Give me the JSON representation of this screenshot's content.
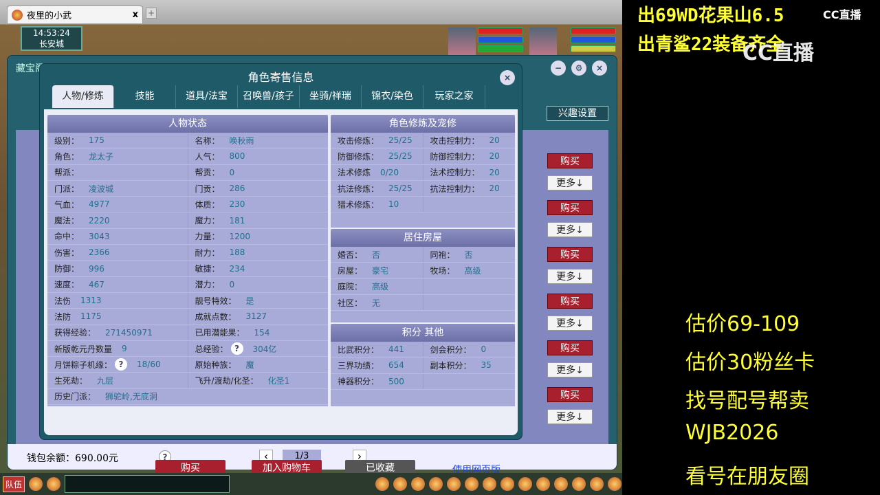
{
  "browser": {
    "tab_title": "夜里的小武",
    "close": "x",
    "new_tab": "+"
  },
  "hud": {
    "time": "14:53:24",
    "location": "长安城"
  },
  "outer": {
    "title": "藏宝阁",
    "interest_btn": "兴趣设置",
    "buy": "购买",
    "more": "更多↓",
    "wallet": "钱包余额：690.00元",
    "help": "?",
    "page": "1/3",
    "prev": "‹",
    "next": "›"
  },
  "dialog": {
    "title": "角色寄售信息",
    "close": "×",
    "tabs": [
      "人物/修炼",
      "技能",
      "道具/法宝",
      "召唤兽/孩子",
      "坐骑/祥瑞",
      "锦衣/染色",
      "玩家之家"
    ],
    "status": {
      "title": "人物状态",
      "rows": [
        [
          [
            "级别：",
            "175"
          ],
          [
            "名称：",
            "唤秋雨"
          ]
        ],
        [
          [
            "角色：",
            "龙太子"
          ],
          [
            "人气：",
            "800"
          ]
        ],
        [
          [
            "帮派：",
            ""
          ],
          [
            "帮贡：",
            "0"
          ]
        ],
        [
          [
            "门派：",
            "凌波城"
          ],
          [
            "门贡：",
            "286"
          ]
        ],
        [
          [
            "气血：",
            "4977"
          ],
          [
            "体质：",
            "230"
          ]
        ],
        [
          [
            "魔法：",
            "2220"
          ],
          [
            "魔力：",
            "181"
          ]
        ],
        [
          [
            "命中：",
            "3043"
          ],
          [
            "力量：",
            "1200"
          ]
        ],
        [
          [
            "伤害：",
            "2366"
          ],
          [
            "耐力：",
            "188"
          ]
        ],
        [
          [
            "防御：",
            "996"
          ],
          [
            "敏捷：",
            "234"
          ]
        ],
        [
          [
            "速度：",
            "467"
          ],
          [
            "潜力：",
            "0"
          ]
        ],
        [
          [
            "法伤",
            "1313"
          ],
          [
            "靓号特效：",
            "是"
          ]
        ],
        [
          [
            "法防",
            "1175"
          ],
          [
            "成就点数：",
            "3127"
          ]
        ],
        [
          [
            "获得经验：",
            "271450971"
          ],
          [
            "已用潜能果：",
            "154"
          ]
        ],
        [
          [
            "新版乾元丹数量",
            "9"
          ],
          [
            "总经验：",
            "304亿",
            "?"
          ]
        ],
        [
          [
            "月饼粽子机缘：",
            "18/60",
            "?"
          ],
          [
            "原始种族：",
            "魔"
          ]
        ],
        [
          [
            "生死劫：",
            "九层"
          ],
          [
            "飞升/渡劫/化圣：",
            "化圣1"
          ]
        ],
        [
          [
            "历史门派：",
            "狮驼岭,无底洞"
          ]
        ]
      ]
    },
    "cultivation": {
      "title": "角色修炼及宠修",
      "rows": [
        [
          [
            "攻击修炼：",
            "25/25"
          ],
          [
            "攻击控制力：",
            "20"
          ]
        ],
        [
          [
            "防御修炼：",
            "25/25"
          ],
          [
            "防御控制力：",
            "20"
          ]
        ],
        [
          [
            "法术修炼",
            "0/20"
          ],
          [
            "法术控制力：",
            "20"
          ]
        ],
        [
          [
            "抗法修炼：",
            "25/25"
          ],
          [
            "抗法控制力：",
            "20"
          ]
        ],
        [
          [
            "猎术修炼：",
            "10"
          ]
        ]
      ]
    },
    "house": {
      "title": "居住房屋",
      "rows": [
        [
          [
            "婚否：",
            "否"
          ],
          [
            "同袍：",
            "否"
          ]
        ],
        [
          [
            "房屋：",
            "豪宅"
          ],
          [
            "牧场：",
            "高级"
          ]
        ],
        [
          [
            "庭院：",
            "高级"
          ]
        ],
        [
          [
            "社区：",
            "无"
          ]
        ]
      ]
    },
    "points": {
      "title": "积分 其他",
      "rows": [
        [
          [
            "比武积分：",
            "441"
          ],
          [
            "剑会积分：",
            "0"
          ]
        ],
        [
          [
            "三界功绩：",
            "654"
          ],
          [
            "副本积分：",
            "35"
          ]
        ],
        [
          [
            "神器积分：",
            "500"
          ]
        ]
      ]
    },
    "buttons": {
      "buy": "购买",
      "cart": "加入购物车",
      "favorited": "已收藏",
      "web": "使用网页版"
    }
  },
  "toolbar": {
    "team": "队伍"
  },
  "overlay": {
    "line1": "出69WD花果山6.5",
    "line2": "出青鲨22装备齐全",
    "logo": "CC直播",
    "right": [
      "估价69-109",
      "估价30粉丝卡",
      "找号配号帮卖",
      " WJB2026",
      "看号在朋友圈"
    ]
  }
}
